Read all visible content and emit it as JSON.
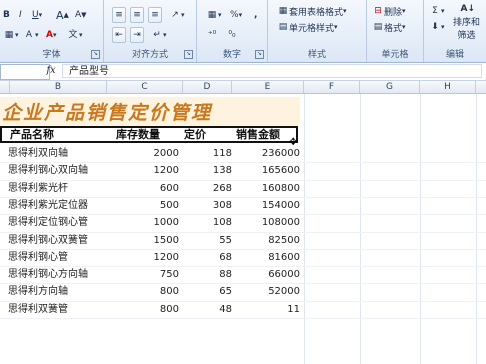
{
  "ribbon": {
    "font_group": {
      "label": "字体",
      "bold": "B",
      "italic": "I",
      "underline": "U",
      "grow": "A",
      "shrink": "A",
      "fill_label": "A",
      "color_label": "A"
    },
    "align_group": {
      "label": "对齐方式"
    },
    "number_group": {
      "label": "数字",
      "percent": "%",
      "comma": ","
    },
    "styles_group": {
      "label": "样式",
      "table_format": "套用表格格式",
      "cell_styles": "单元格样式"
    },
    "cells_group": {
      "label": "单元格",
      "delete": "删除",
      "format": "格式"
    },
    "edit_group": {
      "label": "编辑",
      "sort_filter_1": "排序和",
      "sort_filter_2": "筛选"
    }
  },
  "formula_bar": {
    "fx": "fx",
    "content": "产品型号"
  },
  "columns": [
    "B",
    "C",
    "D",
    "E",
    "F",
    "G",
    "H"
  ],
  "sheet": {
    "title": "企业产品销售定价管理",
    "headers": {
      "name": "产品名称",
      "stock": "库存数量",
      "price": "定价",
      "sales": "销售金额"
    },
    "rows": [
      {
        "name": "思得利双向轴",
        "stock": "2000",
        "price": "118",
        "sales": "236000"
      },
      {
        "name": "思得利钢心双向轴",
        "stock": "1200",
        "price": "138",
        "sales": "165600"
      },
      {
        "name": "思得利紫光杆",
        "stock": "600",
        "price": "268",
        "sales": "160800"
      },
      {
        "name": "思得利紫光定位器",
        "stock": "500",
        "price": "308",
        "sales": "154000"
      },
      {
        "name": "思得利定位钢心管",
        "stock": "1000",
        "price": "108",
        "sales": "108000"
      },
      {
        "name": "思得利钢心双簧管",
        "stock": "1500",
        "price": "55",
        "sales": "82500"
      },
      {
        "name": "思得利钢心管",
        "stock": "1200",
        "price": "68",
        "sales": "81600"
      },
      {
        "name": "思得利钢心方向轴",
        "stock": "750",
        "price": "88",
        "sales": "66000"
      },
      {
        "name": "思得利方向轴",
        "stock": "800",
        "price": "65",
        "sales": "52000"
      },
      {
        "name": "思得利双簧管",
        "stock": "800",
        "price": "48",
        "sales": "11"
      }
    ]
  }
}
